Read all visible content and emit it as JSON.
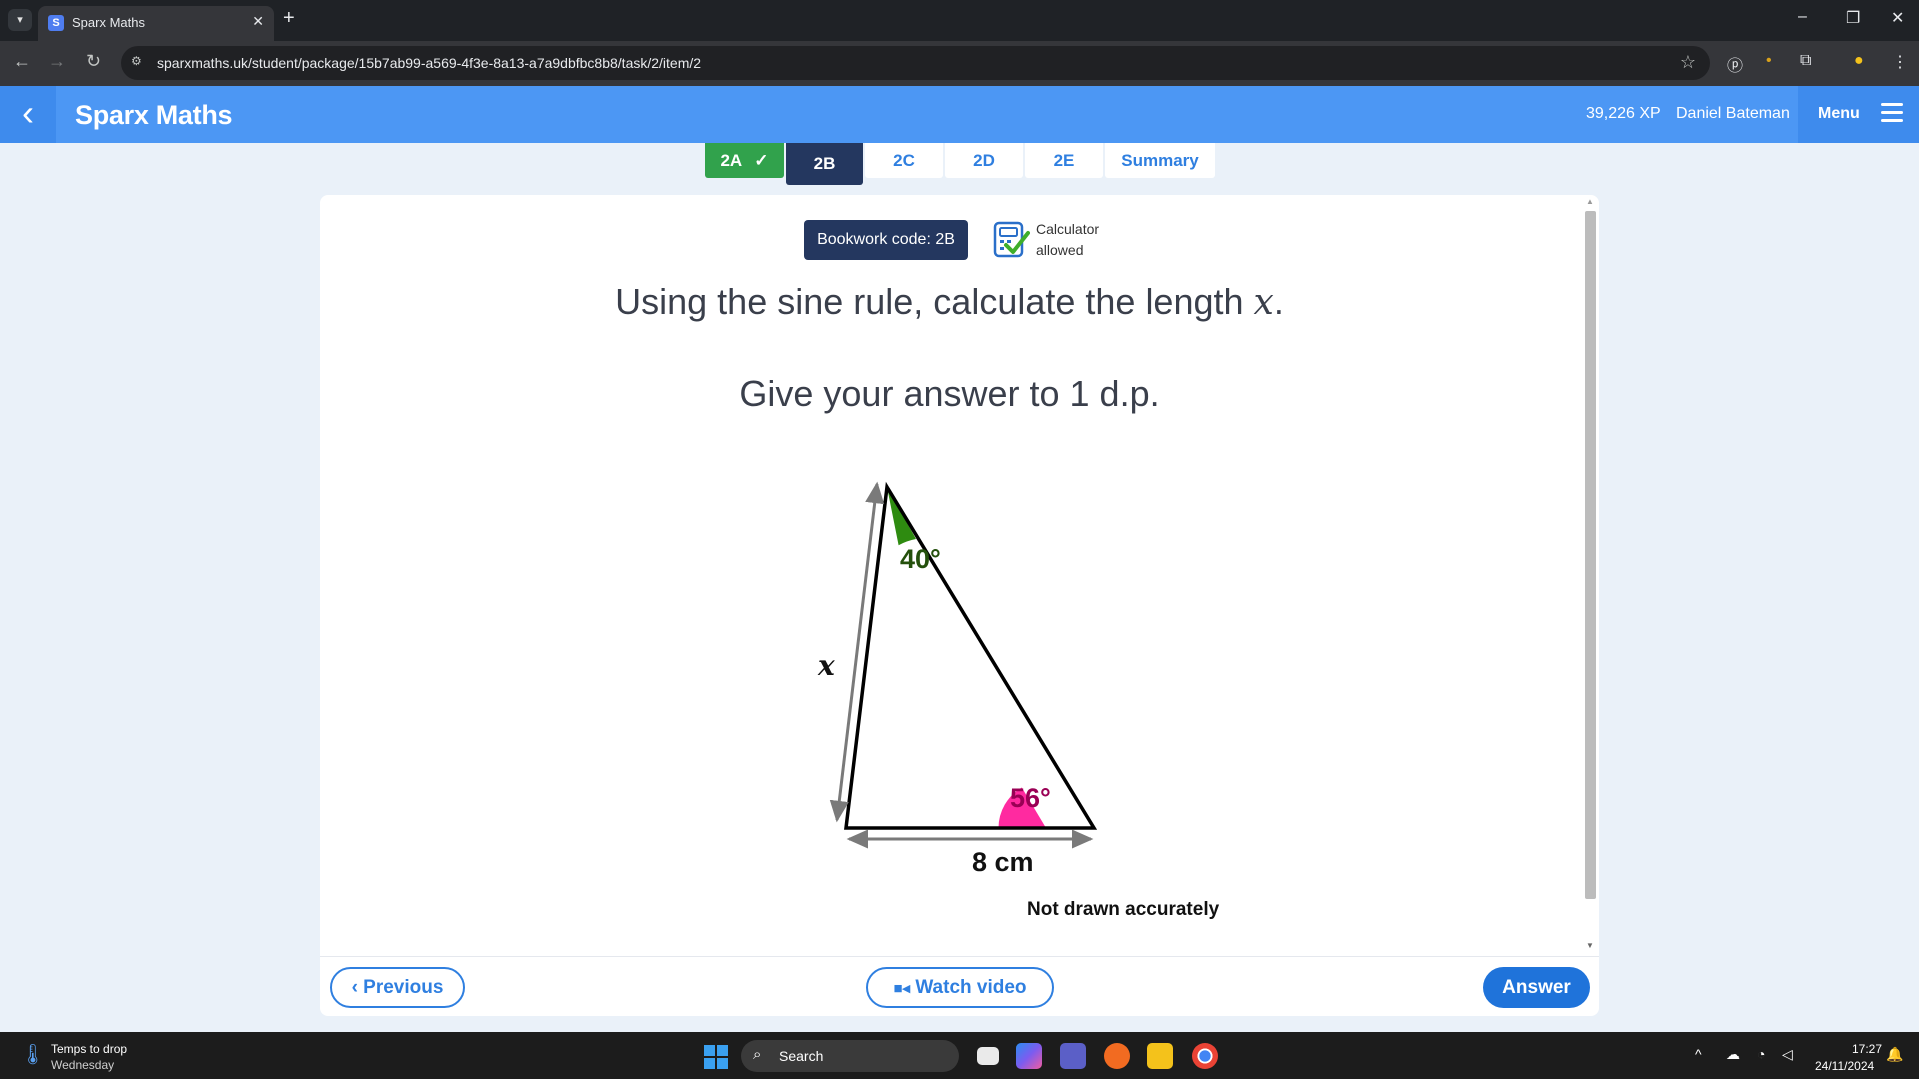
{
  "browser": {
    "tab_title": "Sparx Maths",
    "tab_favicon": "S",
    "close_glyph": "✕",
    "new_tab_glyph": "+",
    "url": "sparxmaths.uk/student/package/15b7ab99-a569-4f3e-8a13-a7a9dbfbc8b8/task/2/item/2"
  },
  "header": {
    "brand": "Sparx Maths",
    "xp": "39,226 XP",
    "user_name": "Daniel Bateman",
    "menu_label": "Menu",
    "brand_color": "#4c97f4"
  },
  "task_tabs": [
    {
      "label": "2A",
      "state": "done"
    },
    {
      "label": "2B",
      "state": "active"
    },
    {
      "label": "2C",
      "state": "normal"
    },
    {
      "label": "2D",
      "state": "normal"
    },
    {
      "label": "2E",
      "state": "normal"
    },
    {
      "label": "Summary",
      "state": "normal"
    }
  ],
  "question": {
    "bookwork_code": "Bookwork code: 2B",
    "calculator_line1": "Calculator",
    "calculator_line2": "allowed",
    "text_before_var": "Using the sine rule, calculate the length ",
    "variable": "x",
    "text_after_var": ".",
    "instruction": "Give your answer to 1 d.p."
  },
  "diagram": {
    "top_angle": "40°",
    "right_angle": "56°",
    "side_label": "x",
    "base_label": "8 cm",
    "note": "Not drawn accurately",
    "top_angle_color": "#2e8b10",
    "right_angle_color": "#ff2aa0"
  },
  "footer": {
    "previous_label": "Previous",
    "video_label": "Watch video",
    "answer_label": "Answer"
  },
  "taskbar": {
    "weather_title": "Temps to drop",
    "weather_sub": "Wednesday",
    "search_label": "Search",
    "time": "17:27",
    "date": "24/11/2024"
  }
}
